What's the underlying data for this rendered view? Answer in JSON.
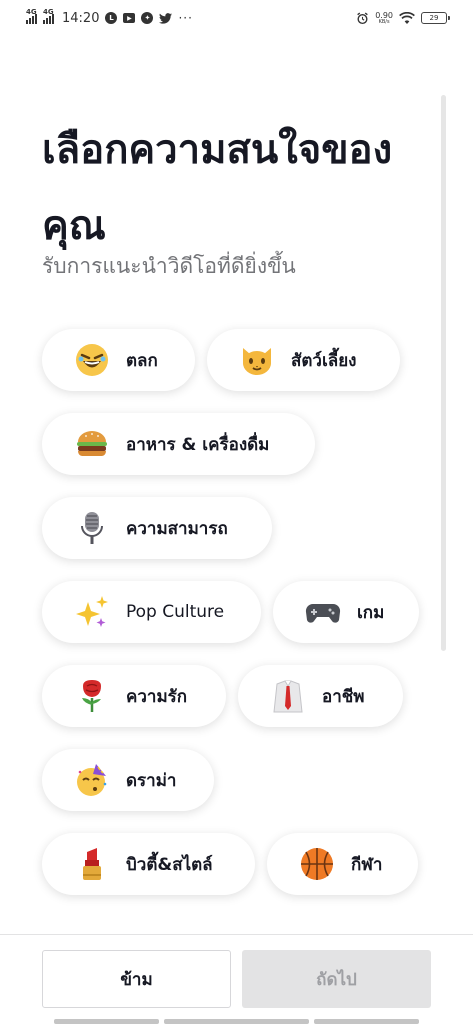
{
  "status_bar": {
    "signal_1": "4G",
    "signal_2": "4G",
    "time": "14:20",
    "net_speed_value": "0.90",
    "net_speed_unit": "KB/s",
    "battery": "29",
    "overflow": "···"
  },
  "header": {
    "title": "เลือกความสนใจของคุณ",
    "subtitle": "รับการแนะนำวิดีโอที่ดียิ่งขึ้น"
  },
  "interests": [
    {
      "label": "ตลก",
      "icon": "laughing-emoji-icon"
    },
    {
      "label": "สัตว์เลี้ยง",
      "icon": "cat-emoji-icon"
    },
    {
      "label": "อาหาร & เครื่องดื่ม",
      "icon": "burger-emoji-icon"
    },
    {
      "label": "ความสามารถ",
      "icon": "microphone-emoji-icon"
    },
    {
      "label": "Pop Culture",
      "icon": "sparkles-emoji-icon"
    },
    {
      "label": "เกม",
      "icon": "gamepad-emoji-icon"
    },
    {
      "label": "ความรัก",
      "icon": "rose-emoji-icon"
    },
    {
      "label": "อาชีพ",
      "icon": "shirt-tie-emoji-icon"
    },
    {
      "label": "ดราม่า",
      "icon": "party-face-emoji-icon"
    },
    {
      "label": "บิวตี้&สไตล์",
      "icon": "lipstick-emoji-icon"
    },
    {
      "label": "กีฬา",
      "icon": "basketball-emoji-icon"
    }
  ],
  "footer": {
    "skip_label": "ข้าม",
    "next_label": "ถัดไป",
    "next_enabled": false
  },
  "colors": {
    "text_primary": "#161823",
    "text_secondary": "#737478",
    "button_disabled_bg": "#e3e3e4",
    "button_disabled_text": "#9fa0a4"
  }
}
